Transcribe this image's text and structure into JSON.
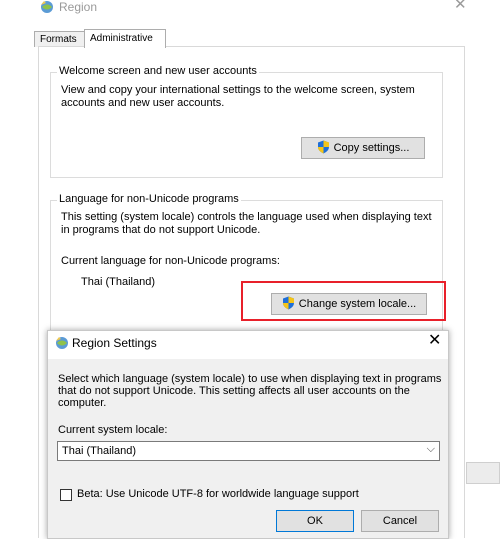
{
  "region_window": {
    "title": "Region",
    "close_glyph": "✕",
    "tabs": [
      {
        "label": "Formats"
      },
      {
        "label": "Administrative"
      }
    ],
    "welcome_group": {
      "title": "Welcome screen and new user accounts",
      "description": "View and copy your international settings to the welcome screen, system accounts and new user accounts.",
      "copy_button": "Copy settings..."
    },
    "nonunicode_group": {
      "title": "Language for non-Unicode programs",
      "description": "This setting (system locale) controls the language used when displaying text in programs that do not support Unicode.",
      "current_label": "Current language for non-Unicode programs:",
      "current_value": "Thai (Thailand)",
      "change_button": "Change system locale..."
    }
  },
  "settings_dialog": {
    "title": "Region Settings",
    "close_glyph": "✕",
    "description": "Select which language (system locale) to use when displaying text in programs that do not support Unicode. This setting affects all user accounts on the computer.",
    "current_label": "Current system locale:",
    "selected_locale": "Thai (Thailand)",
    "chevron_glyph": "⌵",
    "beta_label": "Beta: Use Unicode UTF-8 for worldwide language support",
    "ok_label": "OK",
    "cancel_label": "Cancel"
  },
  "icons": {
    "globe": "globe-icon",
    "shield": "uac-shield-icon"
  },
  "colors": {
    "highlight": "#e8202a",
    "button_bg": "#e1e1e1",
    "dialog_body": "#f0f0f0"
  }
}
